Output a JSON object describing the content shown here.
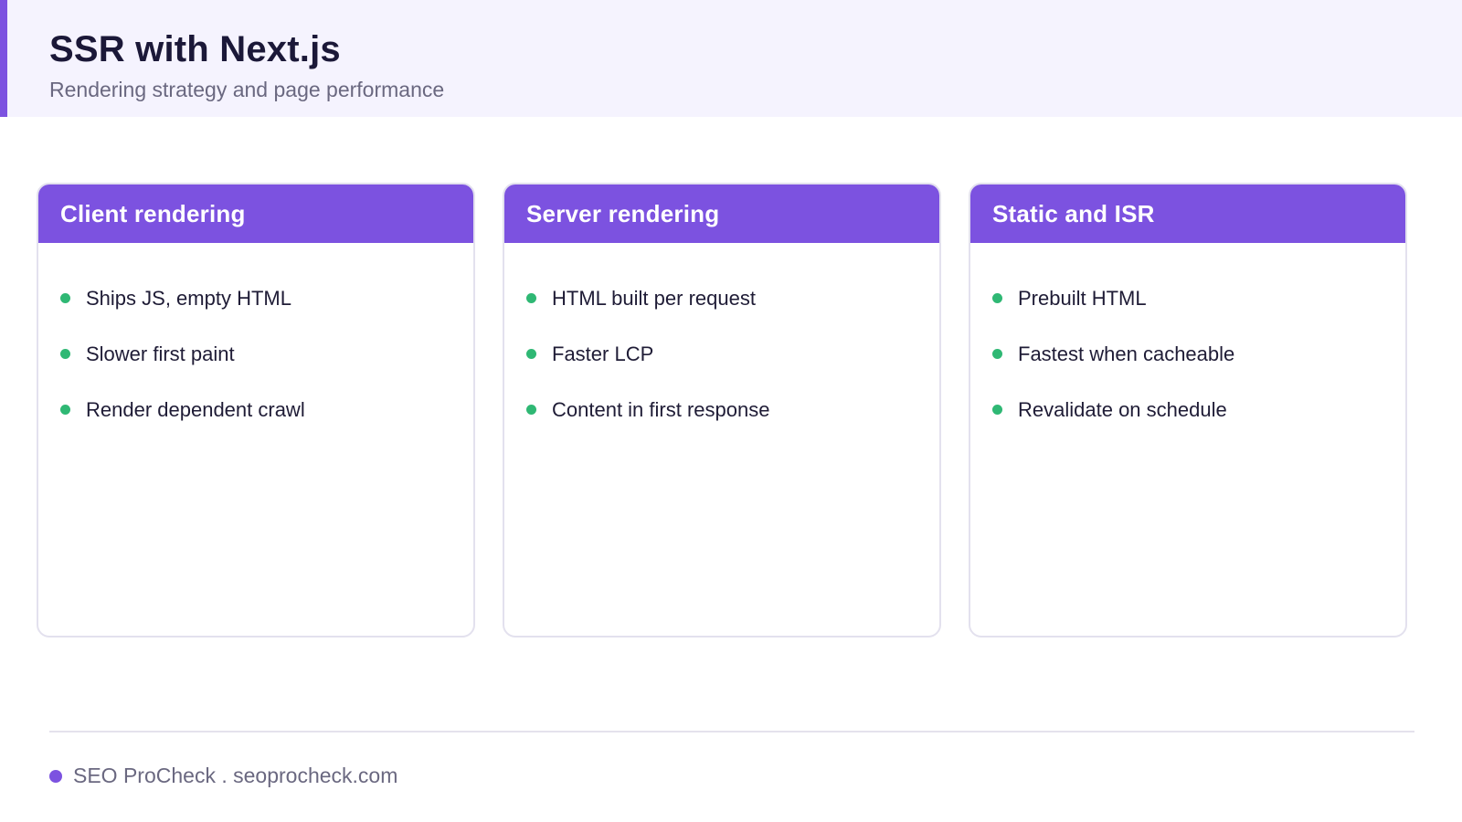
{
  "header": {
    "title": "SSR with Next.js",
    "subtitle": "Rendering strategy and page performance"
  },
  "colors": {
    "accent": "#7c52e0",
    "bullet": "#2fb874",
    "header_bg": "#f5f3fe",
    "title": "#1b1838",
    "muted": "#6a6880"
  },
  "cards": [
    {
      "title": "Client rendering",
      "items": [
        "Ships JS, empty HTML",
        "Slower first paint",
        "Render dependent crawl"
      ]
    },
    {
      "title": "Server rendering",
      "items": [
        "HTML built per request",
        "Faster LCP",
        "Content in first response"
      ]
    },
    {
      "title": "Static and ISR",
      "items": [
        "Prebuilt HTML",
        "Fastest when cacheable",
        "Revalidate on schedule"
      ]
    }
  ],
  "footer": {
    "text": "SEO ProCheck . seoprocheck.com"
  }
}
